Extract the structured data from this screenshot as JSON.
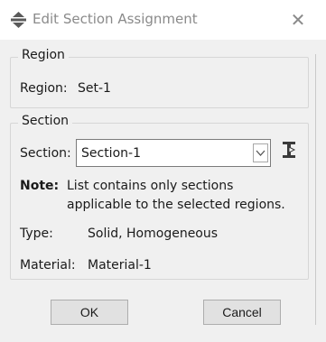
{
  "window": {
    "title": "Edit Section Assignment",
    "close_icon": "close-icon",
    "title_icon": "edit-section-assignment-icon"
  },
  "region_group": {
    "title": "Region",
    "label": "Region:",
    "value": "Set-1"
  },
  "section_group": {
    "title": "Section",
    "label": "Section:",
    "selected": "Section-1",
    "tool_icon": "create-section-icon",
    "note_label": "Note:",
    "note_line1": "List contains only sections",
    "note_line2": "applicable to the selected regions.",
    "type_label": "Type:",
    "type_value": "Solid, Homogeneous",
    "material_label": "Material:",
    "material_value": "Material-1"
  },
  "buttons": {
    "ok": "OK",
    "cancel": "Cancel"
  },
  "colors": {
    "title_text": "#8a8a8a",
    "panel_background": "#f0f0f0",
    "button_background": "#e1e1e1"
  }
}
